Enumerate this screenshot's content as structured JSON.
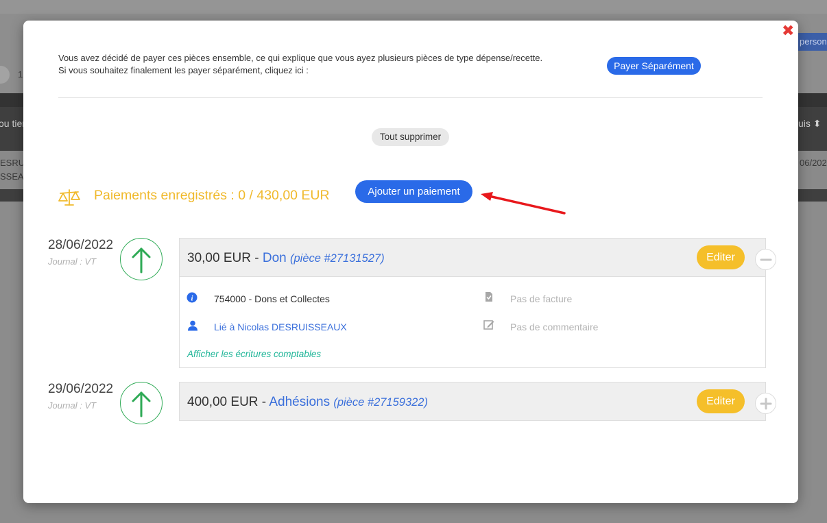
{
  "background": {
    "page_number": "1",
    "top_right_button": "person",
    "table_header_left": "ou tiers",
    "table_header_right": "uis",
    "row_left_line1": "ESRUIS",
    "row_left_line2": "SSEAU",
    "row_right": "06/202"
  },
  "modal": {
    "close_symbol": "✖",
    "intro_line1": "Vous avez décidé de payer ces pièces ensemble, ce qui explique que vous ayez plusieurs pièces de type dépense/recette.",
    "intro_line2": "Si vous souhaitez finalement les payer séparément, cliquez ici :",
    "pay_separately_label": "Payer Séparément",
    "delete_all_label": "Tout supprimer",
    "payments_label": "Paiements enregistrés : 0 / 430,00 EUR",
    "add_payment_label": "Ajouter un paiement",
    "entries": [
      {
        "date": "28/06/2022",
        "journal": "Journal : VT",
        "amount": "30,00 EUR",
        "separator": " - ",
        "category": "Don",
        "reference": "(pièce #27131527)",
        "edit_label": "Editer",
        "expanded": true,
        "details": {
          "account": "754000 - Dons et Collectes",
          "linked_to": "Lié à Nicolas DESRUISSEAUX",
          "invoice": "Pas de facture",
          "comment": "Pas de commentaire",
          "show_entries_link": "Afficher les écritures comptables"
        }
      },
      {
        "date": "29/06/2022",
        "journal": "Journal : VT",
        "amount": "400,00 EUR",
        "separator": " - ",
        "category": "Adhésions",
        "reference": "(pièce #27159322)",
        "edit_label": "Editer",
        "expanded": false
      }
    ]
  },
  "colors": {
    "primary_blue": "#2a6ae8",
    "link_blue": "#3a6fdb",
    "amber": "#f0b92b",
    "edit_yellow": "#f5bf2a",
    "green": "#2eaa55",
    "teal_link": "#1fb598",
    "close_red": "#e53935",
    "annotation_arrow": "#e8181c"
  },
  "icons": {
    "close": "close-icon",
    "balance": "balance-scale-icon",
    "income": "arrow-up-icon",
    "info": "info-icon",
    "user": "user-icon",
    "invoice": "file-check-icon",
    "comment": "edit-note-icon",
    "collapse": "minus-icon",
    "expand": "plus-icon"
  }
}
